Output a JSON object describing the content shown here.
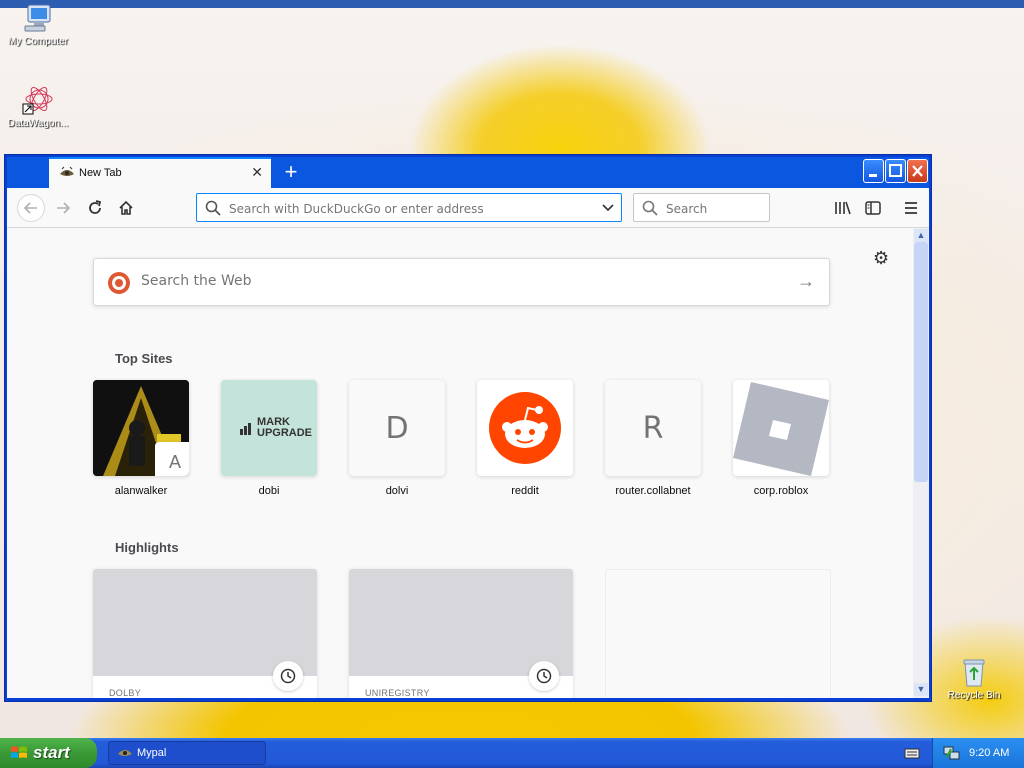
{
  "desktop": {
    "icons": [
      {
        "label": "My Computer"
      },
      {
        "label": "DataWagon..."
      },
      {
        "label": "Recycle Bin"
      }
    ]
  },
  "browser": {
    "tab": {
      "title": "New Tab"
    },
    "url_placeholder": "Search with DuckDuckGo or enter address",
    "search_placeholder": "Search",
    "web_search_placeholder": "Search the Web",
    "top_sites_title": "Top Sites",
    "top_sites": [
      {
        "label": "alanwalker",
        "badge": "A"
      },
      {
        "label": "dobi",
        "logo_text": "MARK UPGRADE"
      },
      {
        "label": "dolvi",
        "letter": "D"
      },
      {
        "label": "reddit"
      },
      {
        "label": "router.collabnet",
        "letter": "R"
      },
      {
        "label": "corp.roblox"
      }
    ],
    "highlights_title": "Highlights",
    "highlights": [
      {
        "source": "DOLBY"
      },
      {
        "source": "UNIREGISTRY"
      },
      {
        "source": ""
      }
    ]
  },
  "taskbar": {
    "start_label": "start",
    "tasks": [
      {
        "label": "Mypal"
      }
    ],
    "clock": "9:20 AM"
  },
  "colors": {
    "window_frame": "#0a3fd6",
    "accent": "#0a84ff",
    "duckduckgo": "#de5833",
    "reddit": "#ff4500",
    "taskbar": "#245ddb",
    "start_green": "#3a9a36"
  }
}
